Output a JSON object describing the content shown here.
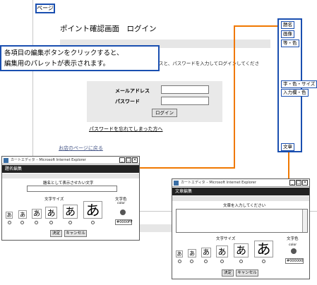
{
  "page": {
    "tag": "ページ",
    "title": "ポイント確認画面　ログイン",
    "instruction": "スと、パスワードを入力してログインしてくださ",
    "email_label": "メールアドレス",
    "password_label": "パスワード",
    "login_button": "ログイン",
    "forgot_link": "パスワードを忘れてしまった方へ",
    "shop_link": "お店のページに戻る"
  },
  "callout": {
    "line1": "各項目の編集ボタンをクリックすると、",
    "line2": "編集用のパレットが表示されます。"
  },
  "panel": {
    "items": [
      "題名",
      "画像",
      "等・色",
      "字・色・サイズ",
      "入力欄・色",
      "文章"
    ]
  },
  "window1": {
    "title": "カートエディタ – Microsoft Internet Explorer",
    "header": "題名編集",
    "prompt": "題名として表示させたい文字",
    "size_label": "文字サイズ",
    "color_label": "文字色",
    "color_sub": "color",
    "glyph": "あ",
    "hex": "#0000FF",
    "ok": "決定",
    "cancel": "キャンセル"
  },
  "window2": {
    "title": "カートエディタ – Microsoft Internet Explorer",
    "header": "文章編集",
    "prompt": "文章を入力してください",
    "size_label": "文字サイズ",
    "color_label": "文字色",
    "color_sub": "color",
    "glyph": "あ",
    "hex": "#000000",
    "ok": "決定",
    "cancel": "キャンセル"
  }
}
